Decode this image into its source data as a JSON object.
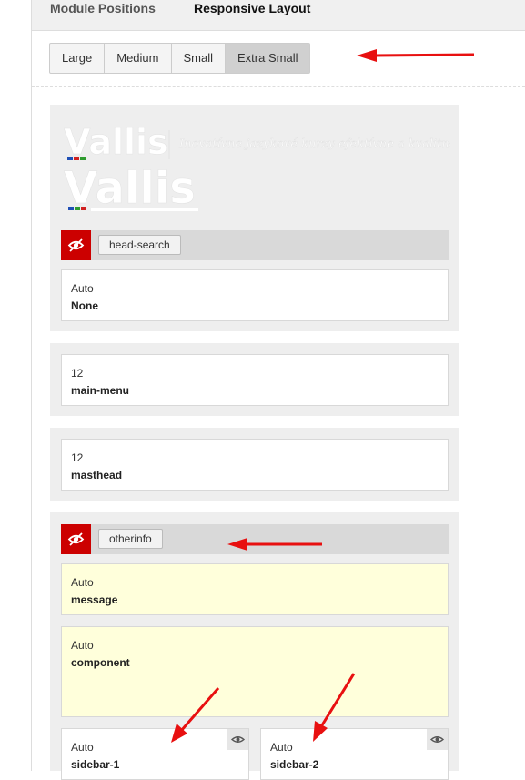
{
  "tabs": [
    {
      "label": "Module Positions",
      "active": false
    },
    {
      "label": "Responsive Layout",
      "active": true
    }
  ],
  "device_buttons": [
    {
      "label": "Large",
      "active": false
    },
    {
      "label": "Medium",
      "active": false
    },
    {
      "label": "Small",
      "active": false
    },
    {
      "label": "Extra Small",
      "active": true
    }
  ],
  "logo": {
    "text_top": "Vallis",
    "text_bottom": "Vallis",
    "tagline": "Inovatívne jazykové kurzy efektívne a kvalitne"
  },
  "header_row": {
    "tag": "head-search",
    "cell": {
      "width": "Auto",
      "name": "None"
    }
  },
  "rows": [
    {
      "width": "12",
      "name": "main-menu"
    },
    {
      "width": "12",
      "name": "masthead"
    }
  ],
  "otherinfo_row": {
    "tag": "otherinfo",
    "cells": [
      {
        "width": "Auto",
        "name": "message"
      },
      {
        "width": "Auto",
        "name": "component"
      }
    ],
    "sidebars": [
      {
        "width": "Auto",
        "name": "sidebar-1"
      },
      {
        "width": "Auto",
        "name": "sidebar-2"
      }
    ]
  },
  "colors": {
    "hide_button": "#cc0000",
    "active_button": "#d0d0d0",
    "highlight_cell": "#ffffdb",
    "annotation_arrow": "#e81010"
  },
  "icons": {
    "hide": "eye-slash-icon",
    "visible": "eye-icon"
  }
}
